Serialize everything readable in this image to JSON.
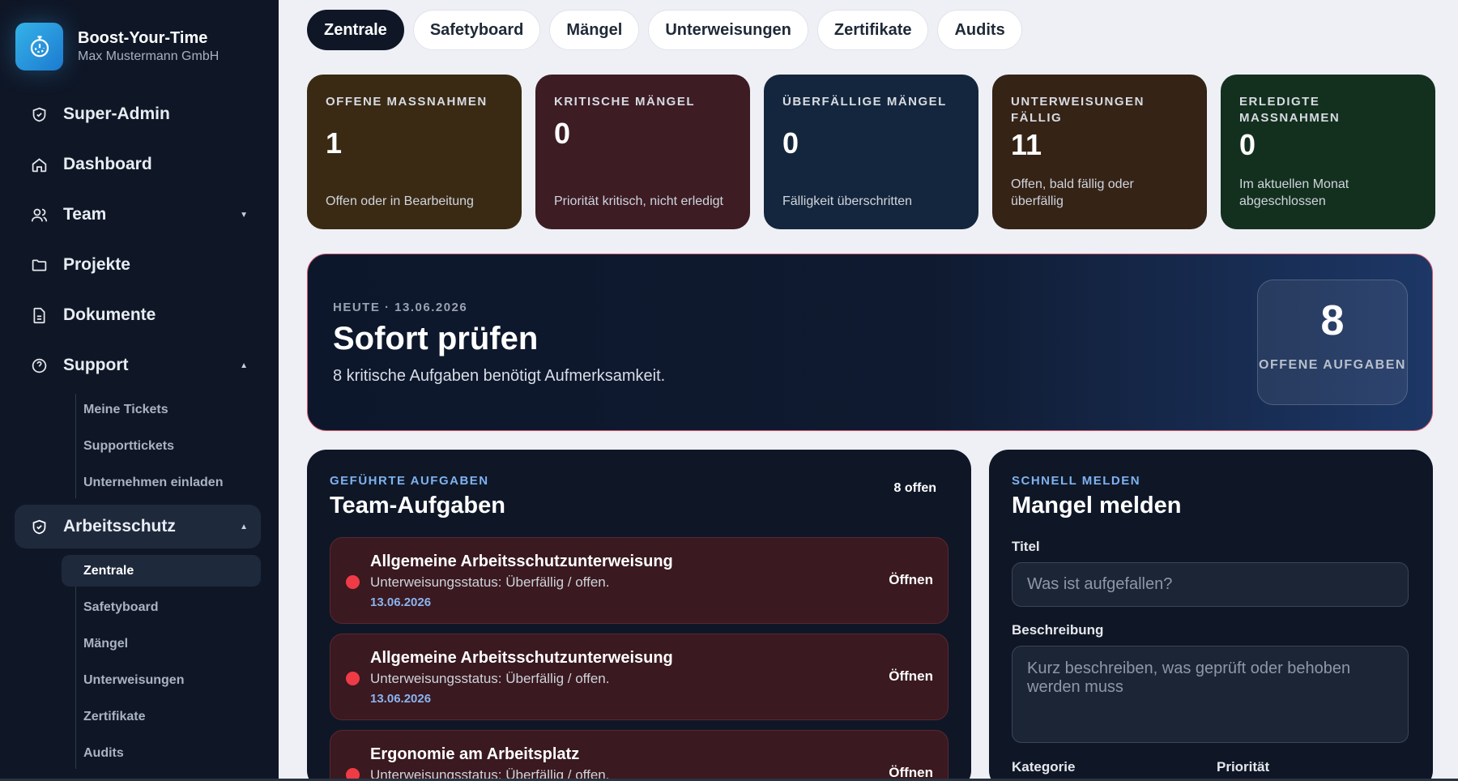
{
  "brand": {
    "name": "Boost-Your-Time",
    "company": "Max Mustermann GmbH",
    "logo_icon": "stopwatch-icon"
  },
  "sidebar": {
    "items": [
      {
        "label": "Super-Admin",
        "icon": "shield-check-icon"
      },
      {
        "label": "Dashboard",
        "icon": "home-icon"
      },
      {
        "label": "Team",
        "icon": "users-icon"
      },
      {
        "label": "Projekte",
        "icon": "folder-icon"
      },
      {
        "label": "Dokumente",
        "icon": "document-icon"
      },
      {
        "label": "Support",
        "icon": "help-circle-icon"
      }
    ],
    "support_sub": [
      "Meine Tickets",
      "Supporttickets",
      "Unternehmen einladen"
    ],
    "arbeitsschutz": {
      "label": "Arbeitsschutz",
      "icon": "shield-check-icon"
    },
    "arbeitsschutz_sub": [
      "Zentrale",
      "Safetyboard",
      "Mängel",
      "Unterweisungen",
      "Zertifikate",
      "Audits"
    ]
  },
  "tabs": [
    "Zentrale",
    "Safetyboard",
    "Mängel",
    "Unterweisungen",
    "Zertifikate",
    "Audits"
  ],
  "cards": [
    {
      "label": "OFFENE MASSNAHMEN",
      "value": "1",
      "desc": "Offen oder in Bearbeitung"
    },
    {
      "label": "KRITISCHE MÄNGEL",
      "value": "0",
      "desc": "Priorität kritisch, nicht erledigt"
    },
    {
      "label": "ÜBERFÄLLIGE MÄNGEL",
      "value": "0",
      "desc": "Fälligkeit überschritten"
    },
    {
      "label": "UNTERWEISUNGEN FÄLLIG",
      "value": "11",
      "desc": "Offen, bald fällig oder überfällig"
    },
    {
      "label": "ERLEDIGTE MASSNAHMEN",
      "value": "0",
      "desc": "Im aktuellen Monat abgeschlossen"
    }
  ],
  "hero": {
    "date": "HEUTE · 13.06.2026",
    "title": "Sofort prüfen",
    "subtitle": "8 kritische Aufgaben benötigt Aufmerksamkeit.",
    "count": "8",
    "count_label": "OFFENE AUFGABEN"
  },
  "tasks_panel": {
    "kicker": "GEFÜHRTE AUFGABEN",
    "title": "Team-Aufgaben",
    "count": "8 offen",
    "tasks": [
      {
        "title": "Allgemeine Arbeitsschutzunterweisung",
        "status": "Unterweisungsstatus: Überfällig / offen.",
        "date": "13.06.2026",
        "action": "Öffnen"
      },
      {
        "title": "Allgemeine Arbeitsschutzunterweisung",
        "status": "Unterweisungsstatus: Überfällig / offen.",
        "date": "13.06.2026",
        "action": "Öffnen"
      },
      {
        "title": "Ergonomie am Arbeitsplatz",
        "status": "Unterweisungsstatus: Überfällig / offen.",
        "action": "Öffnen"
      }
    ]
  },
  "report_panel": {
    "kicker": "SCHNELL MELDEN",
    "title": "Mangel melden",
    "title_label": "Titel",
    "title_placeholder": "Was ist aufgefallen?",
    "desc_label": "Beschreibung",
    "desc_placeholder": "Kurz beschreiben, was geprüft oder behoben werden muss",
    "category_label": "Kategorie",
    "priority_label": "Priorität"
  },
  "colors": {
    "danger_dot": "#ef3b45",
    "accent_blue": "#7fb2f0",
    "brand_gradient_start": "#35b3e8"
  }
}
